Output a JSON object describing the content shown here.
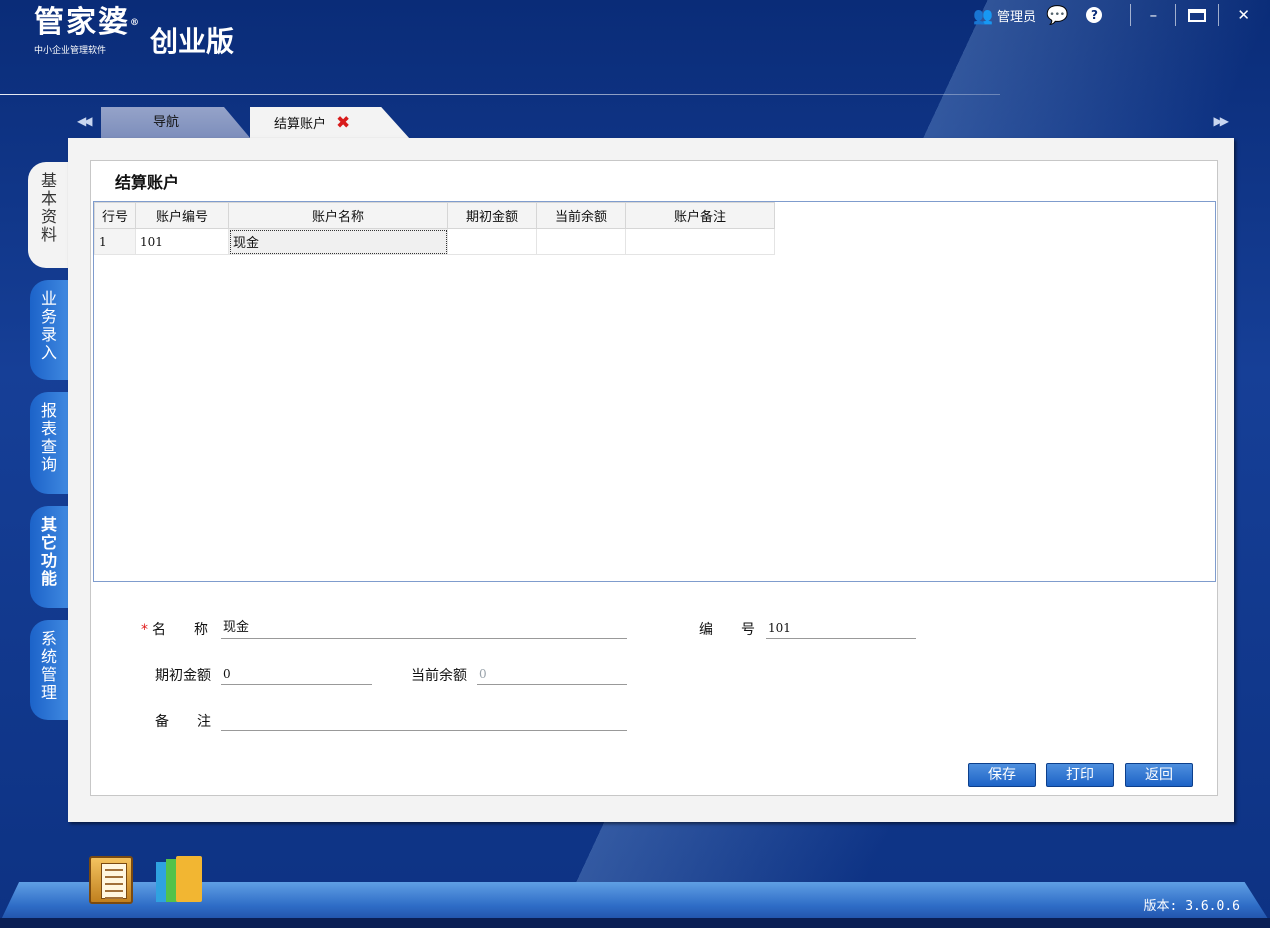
{
  "header": {
    "brand": "管家婆",
    "brand_mark": "®",
    "edition": "创业版",
    "subtitle": "中小企业管理软件",
    "user_label": "管理员"
  },
  "tabs": [
    {
      "label": "导航"
    },
    {
      "label": "结算账户"
    }
  ],
  "side_tabs": [
    "基本资料",
    "业务录入",
    "报表查询",
    "其它功能",
    "系统管理"
  ],
  "page": {
    "title": "结算账户"
  },
  "grid": {
    "columns": [
      "行号",
      "账户编号",
      "账户名称",
      "期初金额",
      "当前余额",
      "账户备注"
    ],
    "rows": [
      [
        "1",
        "101",
        "现金",
        "",
        "",
        ""
      ]
    ]
  },
  "form": {
    "name_label": "名　　称",
    "name_value": "现金",
    "code_label": "编　　号",
    "code_value": "101",
    "opening_label": "期初金额",
    "opening_value": "0",
    "current_label": "当前余额",
    "current_value": "0",
    "note_label": "备　　注",
    "note_value": ""
  },
  "buttons": {
    "save": "保存",
    "print": "打印",
    "back": "返回"
  },
  "footer": {
    "version": "版本: 3.6.0.6"
  }
}
